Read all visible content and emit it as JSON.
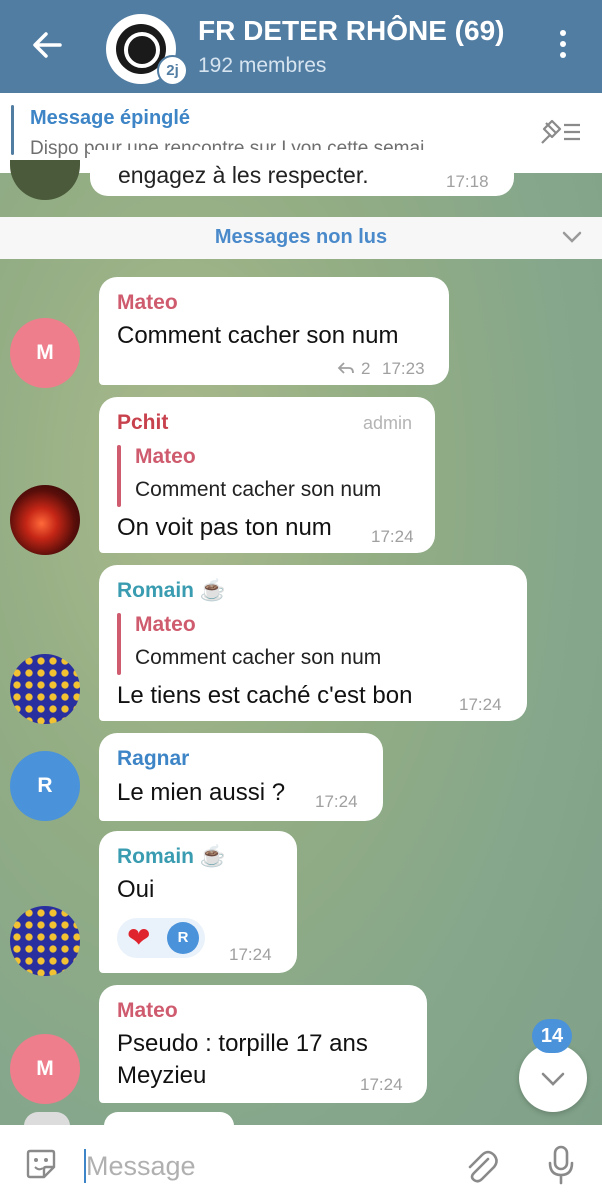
{
  "header": {
    "title": "FR DETER RHÔNE (69)",
    "subtitle": "192 membres",
    "avatar_badge": "2j",
    "bg_color": "#527da3"
  },
  "pinned": {
    "label": "Message épinglé",
    "text": "Dispo pour une rencontre sur Lyon cette semai…"
  },
  "previous_message": {
    "text": "engagez à les respecter.",
    "time": "17:18"
  },
  "unread_label": "Messages non lus",
  "messages": [
    {
      "sender": "Mateo",
      "avatar_letter": "M",
      "text": "Comment cacher son num",
      "reply_count": "2",
      "time": "17:23"
    },
    {
      "sender": "Pchit",
      "role": "admin",
      "quote_sender": "Mateo",
      "quote_text": "Comment cacher son num",
      "text": "On voit pas ton num",
      "time": "17:24"
    },
    {
      "sender": "Romain ☕",
      "quote_sender": "Mateo",
      "quote_text": "Comment cacher son num",
      "text": "Le tiens est caché c'est bon",
      "time": "17:24"
    },
    {
      "sender": "Ragnar",
      "avatar_letter": "R",
      "text": "Le mien aussi ?",
      "time": "17:24"
    },
    {
      "sender": "Romain ☕",
      "text": "Oui",
      "reaction": "❤",
      "reactor_letter": "R",
      "time": "17:24"
    },
    {
      "sender": "Mateo",
      "avatar_letter": "M",
      "text_line1": "Pseudo : torpille  17 ans",
      "text_line2": "Meyzieu",
      "time": "17:24"
    }
  ],
  "unread_count": "14",
  "input": {
    "placeholder": "Message"
  },
  "colors": {
    "mateo": "#cf5b6e",
    "pchit": "#c8424e",
    "romain": "#3a9cb0",
    "ragnar": "#3d85c6",
    "time": "#a0a0a0"
  }
}
